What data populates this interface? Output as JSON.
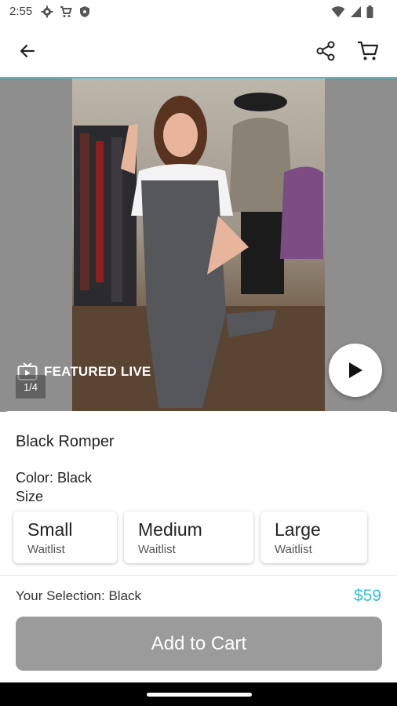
{
  "status_bar": {
    "time": "2:55",
    "left_icons": [
      "gear-icon",
      "cart-icon",
      "shield-icon"
    ],
    "right_icons": [
      "wifi-icon",
      "cellular-signal-icon",
      "battery-icon"
    ]
  },
  "app_bar": {
    "back_icon": "arrow-left-icon",
    "share_icon": "share-icon",
    "cart_icon": "cart-icon",
    "accent_color": "#39c1d9"
  },
  "media": {
    "featured_label": "FEATURED LIVE",
    "page_counter": "1/4",
    "play_icon": "play-icon"
  },
  "product": {
    "name": "Black Romper",
    "color_label": "Color: Black",
    "size_label": "Size",
    "sizes": [
      {
        "name": "Small",
        "status": "Waitlist"
      },
      {
        "name": "Medium",
        "status": "Waitlist"
      },
      {
        "name": "Large",
        "status": "Waitlist"
      }
    ],
    "selection_label": "Your Selection: Black",
    "price": "$59",
    "price_color": "#39c1d9",
    "add_to_cart_label": "Add to Cart",
    "add_to_cart_color": "#9b9b9b"
  }
}
